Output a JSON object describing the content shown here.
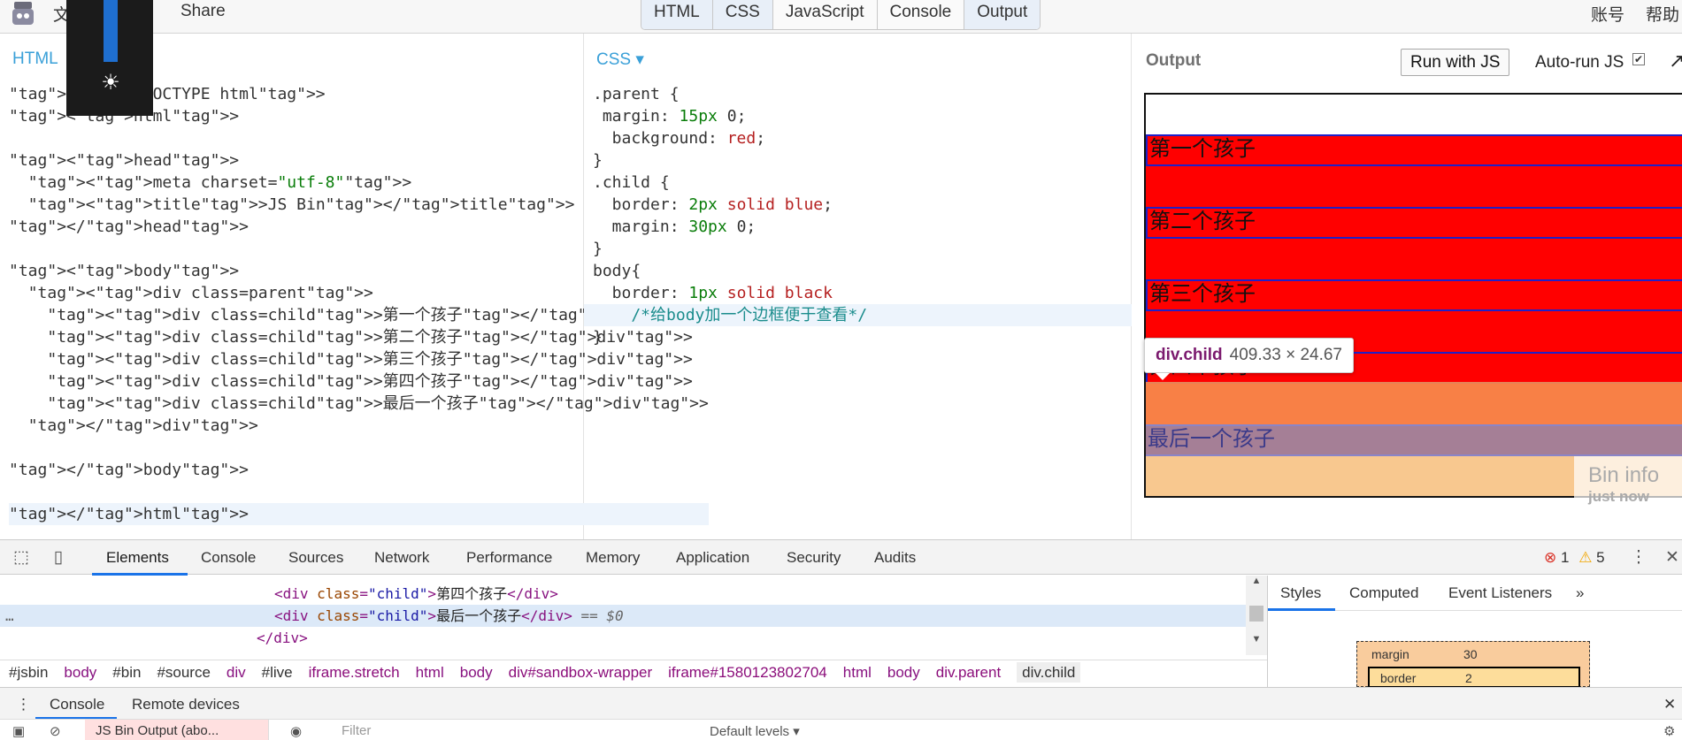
{
  "topbar": {
    "menu_file": "文",
    "share": "Share",
    "account": "账号",
    "help": "帮助",
    "tabs": [
      "HTML",
      "CSS",
      "JavaScript",
      "Console",
      "Output"
    ]
  },
  "html_pane": {
    "title": "HTML",
    "lines": [
      "<!DOCTYPE html>",
      "<html>",
      "",
      "<head>",
      "  <meta charset=\"utf-8\">",
      "  <title>JS Bin</title>",
      "</head>",
      "",
      "<body>",
      "  <div class=parent>",
      "    <div class=child>第一个孩子</div>",
      "    <div class=child>第二个孩子</div>",
      "    <div class=child>第三个孩子</div>",
      "    <div class=child>第四个孩子</div>",
      "    <div class=child>最后一个孩子</div>",
      "  </div>",
      "",
      "</body>",
      "",
      "</html>"
    ]
  },
  "css_pane": {
    "title": "CSS ▾",
    "lines": [
      ".parent {",
      " margin: 15px 0;",
      "  background: red;",
      "}",
      ".child {",
      "  border: 2px solid blue;",
      "  margin: 30px 0;",
      "}",
      "body{",
      "  border: 1px solid black",
      "    /*给body加一个边框便于查看*/",
      "}"
    ]
  },
  "output_pane": {
    "title": "Output",
    "run_button": "Run with JS",
    "autorun_label": "Auto-run JS",
    "autorun_checked": true,
    "children": [
      "第一个孩子",
      "第二个孩子",
      "第三个孩子",
      "第四个孩子",
      "最后一个孩子"
    ],
    "tooltip_name": "div.child",
    "tooltip_size": "409.33 × 24.67",
    "bininfo_title": "Bin info",
    "bininfo_time": "just now"
  },
  "devtools": {
    "tabs": [
      "Elements",
      "Console",
      "Sources",
      "Network",
      "Performance",
      "Memory",
      "Application",
      "Security",
      "Audits"
    ],
    "errors": "1",
    "warnings": "5",
    "dom_lines": [
      {
        "text": "第四个孩子",
        "selected": false
      },
      {
        "text": "最后一个孩子",
        "selected": true,
        "suffix": " == $0"
      }
    ],
    "div_close": "</div>",
    "breadcrumb": [
      "#jsbin",
      "body",
      "#bin",
      "#source",
      "div",
      "#live",
      "iframe.stretch",
      "html",
      "body",
      "div#sandbox-wrapper",
      "iframe#1580123802704",
      "html",
      "body",
      "div.parent",
      "div.child"
    ],
    "styles_tabs": [
      "Styles",
      "Computed",
      "Event Listeners",
      "»"
    ],
    "box_margin_label": "margin",
    "box_margin_value": "30",
    "box_border_label": "border",
    "box_border_value": "2",
    "drawer_tabs": [
      "Console",
      "Remote devices"
    ],
    "context": "JS Bin Output (abo...",
    "filter_placeholder": "Filter",
    "levels": "Default levels ▾"
  },
  "colors": {
    "accent": "#1a73e8",
    "red": "#ff0000",
    "child_border": "#2020c8"
  }
}
